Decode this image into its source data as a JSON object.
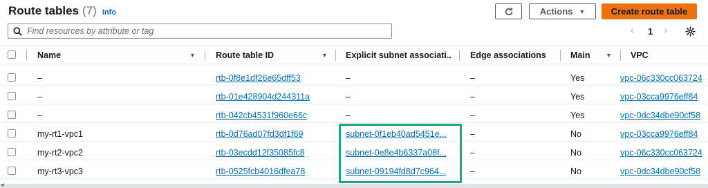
{
  "header": {
    "title": "Route tables",
    "count": "(7)",
    "info": "Info"
  },
  "toolbar": {
    "actions_label": "Actions",
    "create_label": "Create route table"
  },
  "search": {
    "placeholder": "Find resources by attribute or tag"
  },
  "pagination": {
    "current_page": "1"
  },
  "columns": {
    "name": "Name",
    "route_table_id": "Route table ID",
    "explicit_subnet": "Explicit subnet associati...",
    "edge_associations": "Edge associations",
    "main": "Main",
    "vpc": "VPC"
  },
  "rows": [
    {
      "name": "–",
      "route_table_id": "rtb-0f8e1df26e65dff53",
      "explicit_subnet": "–",
      "edge": "–",
      "main": "Yes",
      "vpc": "vpc-06c330cc063724"
    },
    {
      "name": "–",
      "route_table_id": "rtb-01e428904d244311a",
      "explicit_subnet": "–",
      "edge": "–",
      "main": "Yes",
      "vpc": "vpc-03cca9976eff84"
    },
    {
      "name": "–",
      "route_table_id": "rtb-042cb4531f960e66c",
      "explicit_subnet": "–",
      "edge": "–",
      "main": "Yes",
      "vpc": "vpc-0dc34dbe90cf58"
    },
    {
      "name": "my-rt1-vpc1",
      "route_table_id": "rtb-0d76ad07fd3df1f69",
      "explicit_subnet": "subnet-0f1eb40ad5451e...",
      "edge": "–",
      "main": "No",
      "vpc": "vpc-03cca9976eff84"
    },
    {
      "name": "my-rt2-vpc2",
      "route_table_id": "rtb-03ecdd12f35085fc8",
      "explicit_subnet": "subnet-0e8e4b6337a08f...",
      "edge": "–",
      "main": "No",
      "vpc": "vpc-06c330cc063724"
    },
    {
      "name": "my-rt3-vpc3",
      "route_table_id": "rtb-0525fcb4016dfea78",
      "explicit_subnet": "subnet-09194fd8d7c964...",
      "edge": "–",
      "main": "No",
      "vpc": "vpc-0dc34dbe90cf58"
    }
  ],
  "colors": {
    "primary_button": "#ec7211",
    "link": "#0073bb",
    "highlight_box": "#1aa583"
  },
  "icons": {
    "refresh": "refresh-icon",
    "actions_caret": "caret-down-icon",
    "search": "search-icon",
    "prev_page": "chevron-left-icon",
    "next_page": "chevron-right-icon",
    "settings": "gear-icon"
  }
}
